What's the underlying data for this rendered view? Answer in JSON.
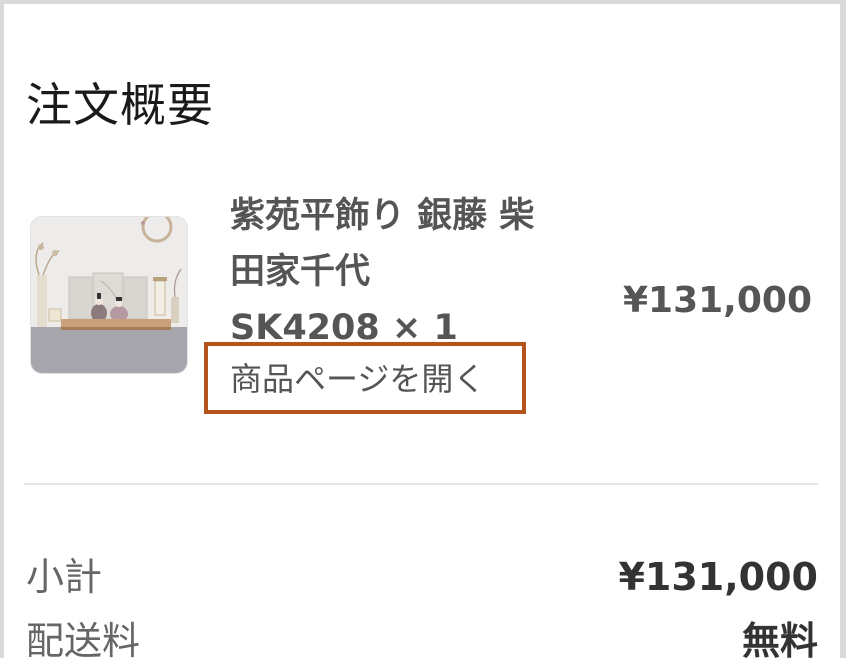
{
  "order_summary": {
    "title": "注文概要",
    "product": {
      "name_line1": "紫苑平飾り 銀藤 柴",
      "name_line2": "田家千代",
      "sku_qty": "SK4208 × 1",
      "open_page_label": "商品ページを開く",
      "price": "¥131,000",
      "image_alt": "紫苑平飾り 銀藤 柴田家千代"
    },
    "subtotal": {
      "label": "小計",
      "value": "¥131,000"
    },
    "shipping": {
      "label": "配送料",
      "value": "無料"
    }
  },
  "colors": {
    "highlight_border": "#b5531c",
    "text_muted": "#555555",
    "divider": "#e4e4e4"
  }
}
